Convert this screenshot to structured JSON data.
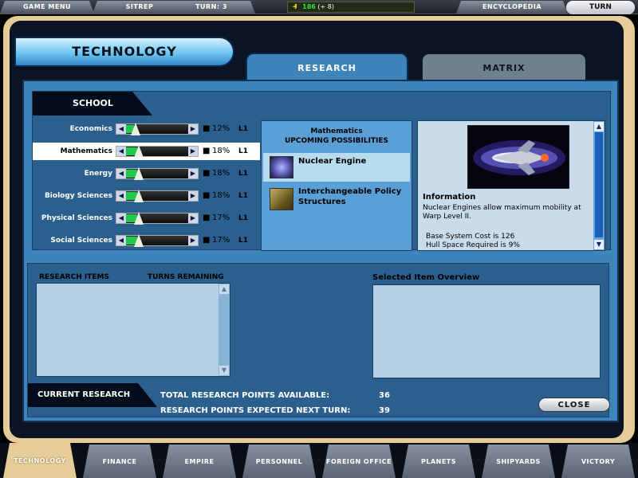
{
  "topbar": {
    "game_menu": "GAME MENU",
    "sitrep": "SITREP",
    "turn_counter": "TURN: 3",
    "credits_value": "186",
    "credits_delta": "(+ 8)",
    "encyclopedia": "ENCYCLOPEDIA",
    "turn_button": "TURN"
  },
  "header": {
    "title": "TECHNOLOGY"
  },
  "tabs": {
    "research": "RESEARCH",
    "matrix": "MATRIX"
  },
  "school": {
    "label": "SCHOOL",
    "rows": [
      {
        "name": "Economics",
        "percent": "12%",
        "percent_value": 12,
        "level": "L1",
        "selected": false
      },
      {
        "name": "Mathematics",
        "percent": "18%",
        "percent_value": 18,
        "level": "L1",
        "selected": true
      },
      {
        "name": "Energy",
        "percent": "18%",
        "percent_value": 18,
        "level": "L1",
        "selected": false
      },
      {
        "name": "Biology Sciences",
        "percent": "18%",
        "percent_value": 18,
        "level": "L1",
        "selected": false
      },
      {
        "name": "Physical Sciences",
        "percent": "17%",
        "percent_value": 17,
        "level": "L1",
        "selected": false
      },
      {
        "name": "Social Sciences",
        "percent": "17%",
        "percent_value": 17,
        "level": "L1",
        "selected": false
      }
    ]
  },
  "possibilities": {
    "school": "Mathematics",
    "heading": "UPCOMING POSSIBILITIES",
    "items": [
      {
        "name": "Nuclear Engine",
        "selected": true
      },
      {
        "name": "Interchangeable Policy Structures",
        "selected": false
      }
    ]
  },
  "info": {
    "heading": "Information",
    "body": "Nuclear Engines allow maximum mobility at Warp Level II.",
    "cost": "Base System Cost is 126",
    "hull": "Hull Space Required is 9%"
  },
  "lower": {
    "research_items": "RESEARCH ITEMS",
    "turns_remaining": "TURNS REMAINING",
    "selected_overview": "Selected Item Overview",
    "current_research": "CURRENT RESEARCH",
    "total_label": "TOTAL RESEARCH POINTS AVAILABLE:",
    "total_value": "36",
    "next_label": "RESEARCH POINTS EXPECTED NEXT TURN:",
    "next_value": "39",
    "close": "CLOSE"
  },
  "bottomnav": [
    {
      "label": "TECHNOLOGY",
      "active": true
    },
    {
      "label": "FINANCE",
      "active": false
    },
    {
      "label": "EMPIRE",
      "active": false
    },
    {
      "label": "PERSONNEL",
      "active": false
    },
    {
      "label": "FOREIGN OFFICE",
      "active": false
    },
    {
      "label": "PLANETS",
      "active": false
    },
    {
      "label": "SHIPYARDS",
      "active": false
    },
    {
      "label": "VICTORY",
      "active": false
    }
  ],
  "colors": {
    "frame": "#e5cc98",
    "panel": "#3e83b9",
    "slider_fill": "#21c94a"
  }
}
